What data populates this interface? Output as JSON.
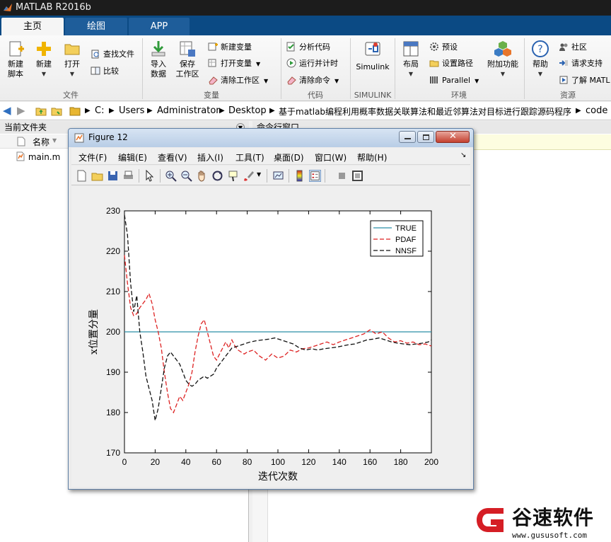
{
  "app": {
    "title": "MATLAB R2016b"
  },
  "tabs": [
    {
      "label": "主页",
      "active": true
    },
    {
      "label": "绘图",
      "active": false
    },
    {
      "label": "APP",
      "active": false
    }
  ],
  "ribbon": {
    "file": {
      "group_label": "文件",
      "new_script": "新建\n脚本",
      "new": "新建",
      "open": "打开",
      "find_files": "查找文件",
      "compare": "比较"
    },
    "variable": {
      "group_label": "变量",
      "import_data": "导入\n数据",
      "save_workspace": "保存\n工作区",
      "new_variable": "新建变量",
      "open_variable": "打开变量",
      "clear_workspace": "清除工作区"
    },
    "code": {
      "group_label": "代码",
      "analyze_code": "分析代码",
      "run_time": "运行并计时",
      "clear_commands": "清除命令"
    },
    "simulink": {
      "group_label": "SIMULINK",
      "label": "Simulink"
    },
    "environment": {
      "group_label": "环境",
      "layout": "布局",
      "preferences": "预设",
      "set_path": "设置路径",
      "parallel": "Parallel",
      "addons": "附加功能"
    },
    "resources": {
      "group_label": "资源",
      "help": "帮助",
      "community": "社区",
      "request_support": "请求支持",
      "learn": "了解 MATL"
    }
  },
  "address": {
    "segments": [
      "C:",
      "Users",
      "Administrator",
      "Desktop",
      "基于matlab编程利用概率数据关联算法和最近邻算法对目标进行跟踪源码程序",
      "code"
    ]
  },
  "left_panel": {
    "title": "当前文件夹",
    "column_name": "名称",
    "files": [
      "main.m"
    ]
  },
  "right_panel": {
    "title": "命令行窗口"
  },
  "figure": {
    "title": "Figure 12",
    "menu": [
      "文件(F)",
      "编辑(E)",
      "查看(V)",
      "插入(I)",
      "工具(T)",
      "桌面(D)",
      "窗口(W)",
      "帮助(H)"
    ]
  },
  "chart_data": {
    "type": "line",
    "title": "",
    "xlabel": "迭代次数",
    "ylabel": "x位置分量",
    "xlim": [
      0,
      200
    ],
    "ylim": [
      170,
      230
    ],
    "xticks": [
      0,
      20,
      40,
      60,
      80,
      100,
      120,
      140,
      160,
      180,
      200
    ],
    "yticks": [
      170,
      180,
      190,
      200,
      210,
      220,
      230
    ],
    "grid": false,
    "legend_position": "top-right",
    "series": [
      {
        "name": "TRUE",
        "color": "#2a8fa8",
        "style": "solid",
        "x": [
          0,
          200
        ],
        "y": [
          200,
          200
        ]
      },
      {
        "name": "PDAF",
        "color": "#dd2222",
        "style": "dashed",
        "x": [
          0,
          2,
          4,
          6,
          8,
          10,
          12,
          14,
          16,
          18,
          20,
          22,
          24,
          26,
          28,
          30,
          32,
          34,
          36,
          38,
          40,
          42,
          44,
          46,
          48,
          50,
          52,
          54,
          56,
          58,
          60,
          62,
          64,
          66,
          68,
          70,
          72,
          74,
          76,
          78,
          80,
          84,
          88,
          92,
          96,
          100,
          104,
          108,
          112,
          116,
          120,
          124,
          128,
          132,
          136,
          140,
          144,
          148,
          152,
          156,
          160,
          164,
          168,
          172,
          176,
          180,
          184,
          188,
          192,
          196,
          200
        ],
        "y": [
          219,
          212,
          206,
          204,
          204.5,
          206,
          207,
          208,
          209.5,
          207,
          203,
          200,
          196,
          190,
          185,
          181,
          180,
          182,
          184,
          183,
          185,
          187,
          190,
          195,
          199,
          202,
          203,
          200,
          197,
          194,
          193,
          194.5,
          196,
          197.5,
          196,
          198,
          196.5,
          195.5,
          195,
          194.5,
          195,
          195.5,
          194,
          193,
          194.5,
          193.5,
          194,
          195.5,
          195,
          195.8,
          196,
          196.5,
          197,
          197.5,
          196.8,
          197.5,
          198,
          198.5,
          199,
          199.5,
          200.5,
          199.5,
          200,
          198.5,
          197.5,
          197.8,
          197.2,
          197.5,
          196.8,
          197,
          196.5
        ]
      },
      {
        "name": "NNSF",
        "color": "#111111",
        "style": "dashed",
        "x": [
          0,
          2,
          4,
          6,
          8,
          10,
          12,
          14,
          16,
          18,
          20,
          22,
          24,
          26,
          28,
          30,
          32,
          34,
          36,
          38,
          40,
          42,
          44,
          46,
          48,
          50,
          52,
          54,
          56,
          58,
          60,
          62,
          64,
          66,
          68,
          70,
          74,
          78,
          82,
          86,
          90,
          94,
          98,
          102,
          106,
          110,
          114,
          118,
          122,
          126,
          130,
          134,
          138,
          142,
          146,
          150,
          154,
          158,
          162,
          166,
          170,
          174,
          178,
          182,
          186,
          190,
          194,
          198,
          200
        ],
        "y": [
          229,
          224,
          212,
          205,
          209,
          200,
          195,
          189,
          186,
          183,
          178,
          181,
          186,
          191,
          194,
          195,
          194,
          193,
          192,
          190,
          188,
          187,
          186.5,
          187,
          188,
          188.5,
          189,
          188.5,
          189,
          189.5,
          191,
          192,
          193,
          194,
          195,
          196,
          196.5,
          197,
          197.5,
          197.8,
          198,
          198.2,
          198.5,
          198,
          197.5,
          197,
          196,
          195.5,
          195.8,
          195.5,
          195.8,
          196,
          196.2,
          196.5,
          196.8,
          197,
          197.5,
          198,
          198.2,
          198.5,
          198,
          197.5,
          197.2,
          197,
          196.8,
          197,
          197.2,
          197.5,
          198
        ]
      }
    ]
  },
  "watermark": {
    "brand": "谷速软件",
    "url": "www.gususoft.com"
  }
}
